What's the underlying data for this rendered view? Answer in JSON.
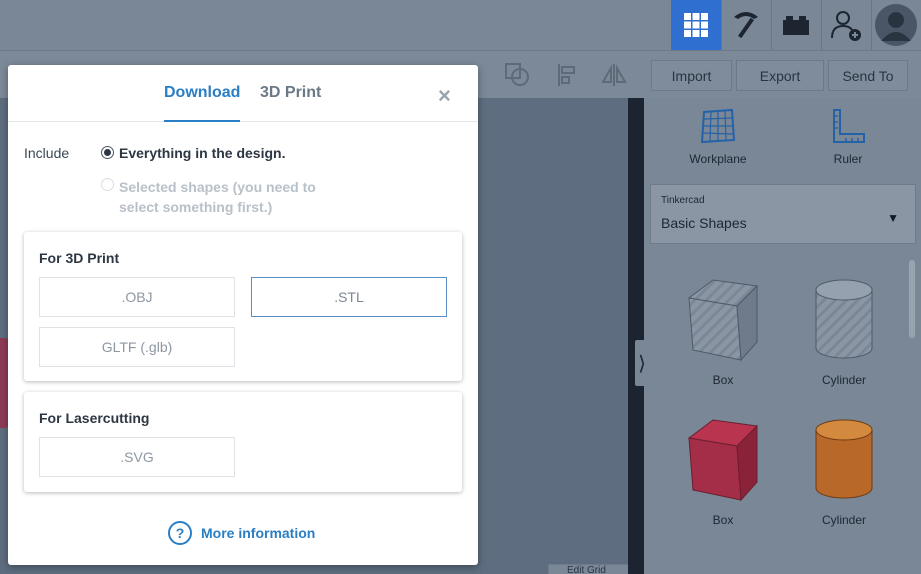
{
  "topbar": {
    "buttons": [
      "grid-view-icon",
      "pickaxe-icon",
      "bricks-icon",
      "add-user-icon",
      "avatar"
    ],
    "accent_color": "#2e6fd0"
  },
  "toolbar": {
    "import_label": "Import",
    "export_label": "Export",
    "send_to_label": "Send To"
  },
  "workspace": {
    "edit_grid_label": "Edit Grid"
  },
  "right_panel": {
    "tools": [
      {
        "label": "Workplane",
        "icon": "workplane-icon"
      },
      {
        "label": "Ruler",
        "icon": "ruler-icon"
      }
    ],
    "library": {
      "category": "Tinkercad",
      "selected": "Basic Shapes"
    },
    "shapes": [
      {
        "label": "Box",
        "color": "#8a96a4"
      },
      {
        "label": "Cylinder",
        "color": "#8a96a4"
      },
      {
        "label": "Box",
        "color": "#b8344f"
      },
      {
        "label": "Cylinder",
        "color": "#c8742b"
      }
    ]
  },
  "modal": {
    "tabs": [
      {
        "label": "Download",
        "active": true
      },
      {
        "label": "3D Print",
        "active": false
      }
    ],
    "close_glyph": "×",
    "include_label": "Include",
    "options": [
      {
        "label": "Everything in the design.",
        "checked": true,
        "disabled": false
      },
      {
        "label": "Selected shapes (you need to select something first.)",
        "checked": false,
        "disabled": true
      }
    ],
    "sections": [
      {
        "title": "For 3D Print",
        "formats": [
          ".OBJ",
          ".STL",
          "GLTF (.glb)"
        ]
      },
      {
        "title": "For Lasercutting",
        "formats": [
          ".SVG"
        ]
      }
    ],
    "more_info_label": "More information",
    "link_color": "#2a7ec4"
  }
}
